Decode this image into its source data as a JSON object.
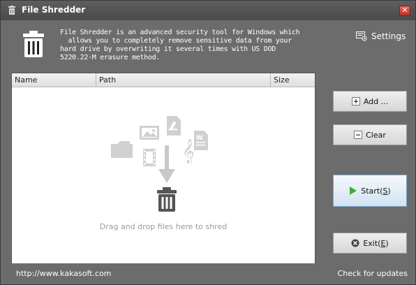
{
  "window": {
    "title": "File Shredder",
    "close_glyph": "✕"
  },
  "header": {
    "description": "File Shredder is an advanced security tool for Windows which\n  allows you to completely remove sensitive data from your\nhard drive by overwriting it several times with US DOD\n5220.22-M erasure method.",
    "settings_label": "Settings"
  },
  "file_list": {
    "columns": [
      "Name",
      "Path",
      "Size"
    ],
    "rows": [],
    "empty_hint": "Drag and drop files here to shred"
  },
  "buttons": {
    "add_label": "Add ...",
    "clear_label": "Clear",
    "start_label": "Start(",
    "start_hotkey": "S",
    "start_suffix": ")",
    "exit_label": "Exit(",
    "exit_hotkey": "E",
    "exit_suffix": ")"
  },
  "footer": {
    "url": "http://www.kakasoft.com",
    "updates_link": "Check for updates"
  },
  "colors": {
    "chrome": "#6c6c6c",
    "start_accent": "#3fae2c",
    "close_red": "#c9443a"
  }
}
